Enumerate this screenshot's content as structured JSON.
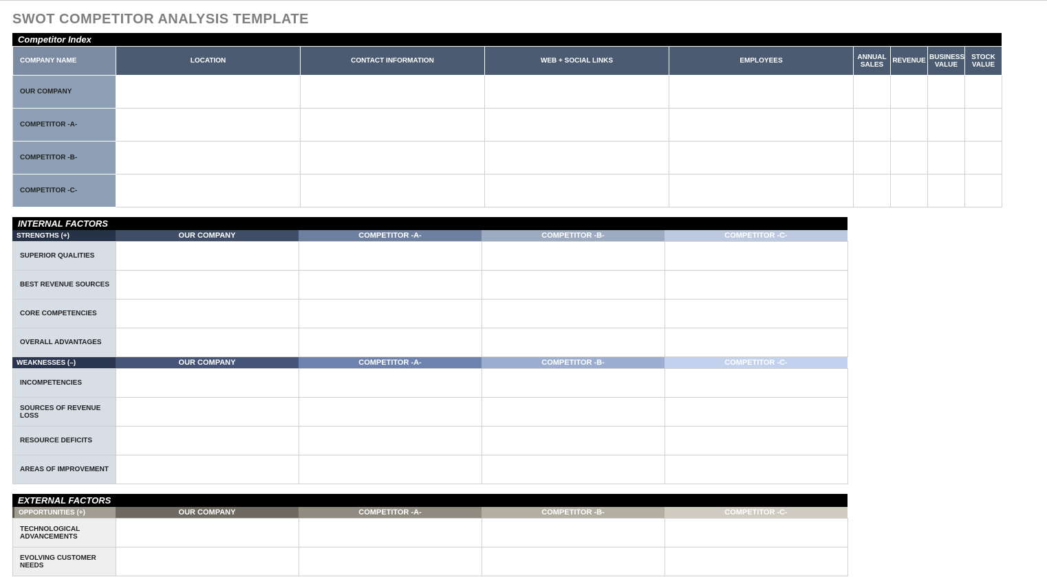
{
  "title": "SWOT COMPETITOR ANALYSIS TEMPLATE",
  "index": {
    "section_label": "Competitor Index",
    "headers": {
      "name": "COMPANY NAME",
      "location": "LOCATION",
      "contact": "CONTACT INFORMATION",
      "web": "WEB + SOCIAL LINKS",
      "employees": "EMPLOYEES",
      "annual_sales": "ANNUAL SALES",
      "revenue": "REVENUE",
      "business_value": "BUSINESS VALUE",
      "stock_value": "STOCK VALUE"
    },
    "rows": {
      "r0": "OUR COMPANY",
      "r1": "COMPETITOR -A-",
      "r2": "COMPETITOR -B-",
      "r3": "COMPETITOR -C-"
    }
  },
  "cols": {
    "c1": "OUR COMPANY",
    "c2": "COMPETITOR -A-",
    "c3": "COMPETITOR -B-",
    "c4": "COMPETITOR -C-"
  },
  "internal": {
    "section_label": "INTERNAL FACTORS",
    "strengths": {
      "label": "STRENGTHS (+)",
      "rows": {
        "r0": "SUPERIOR QUALITIES",
        "r1": "BEST REVENUE SOURCES",
        "r2": "CORE COMPETENCIES",
        "r3": "OVERALL ADVANTAGES"
      }
    },
    "weaknesses": {
      "label": "WEAKNESSES (–)",
      "rows": {
        "r0": "INCOMPETENCIES",
        "r1": "SOURCES OF REVENUE LOSS",
        "r2": "RESOURCE DEFICITS",
        "r3": "AREAS OF IMPROVEMENT"
      }
    }
  },
  "external": {
    "section_label": "EXTERNAL FACTORS",
    "opportunities": {
      "label": "OPPORTUNITIES (+)",
      "rows": {
        "r0": "TECHNOLOGICAL ADVANCEMENTS",
        "r1": "EVOLVING CUSTOMER NEEDS"
      }
    }
  }
}
